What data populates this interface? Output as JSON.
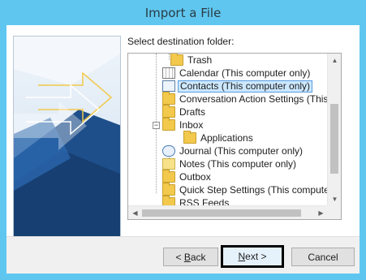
{
  "window": {
    "title": "Import a File"
  },
  "prompt": "Select destination folder:",
  "tree": {
    "items": [
      {
        "label": "Trash",
        "icon": "folder-icon",
        "indent": 1,
        "selected": false
      },
      {
        "label": "Calendar (This computer only)",
        "icon": "calendar-icon",
        "indent": 0,
        "selected": false
      },
      {
        "label": "Contacts (This computer only)",
        "icon": "contacts-icon",
        "indent": 0,
        "selected": true
      },
      {
        "label": "Conversation Action Settings (This c",
        "icon": "folder-icon",
        "indent": 0,
        "selected": false
      },
      {
        "label": "Drafts",
        "icon": "folder-icon",
        "indent": 0,
        "selected": false
      },
      {
        "label": "Inbox",
        "icon": "inbox-icon",
        "indent": 0,
        "selected": false,
        "expander": "−"
      },
      {
        "label": "Applications",
        "icon": "folder-icon",
        "indent": 1,
        "selected": false
      },
      {
        "label": "Journal (This computer only)",
        "icon": "journal-icon",
        "indent": 0,
        "selected": false
      },
      {
        "label": "Notes (This computer only)",
        "icon": "notes-icon",
        "indent": 0,
        "selected": false
      },
      {
        "label": "Outbox",
        "icon": "outbox-icon",
        "indent": 0,
        "selected": false
      },
      {
        "label": "Quick Step Settings (This computer c",
        "icon": "folder-icon",
        "indent": 0,
        "selected": false
      },
      {
        "label": "RSS Feeds",
        "icon": "folder-icon",
        "indent": 0,
        "selected": false
      }
    ]
  },
  "buttons": {
    "back": {
      "pre": "< ",
      "accel": "B",
      "post": "ack"
    },
    "next": {
      "accel": "N",
      "post": "ext >"
    },
    "cancel": "Cancel"
  },
  "colors": {
    "titlebar": "#5fc7ef",
    "selection": "#cce8ff"
  }
}
